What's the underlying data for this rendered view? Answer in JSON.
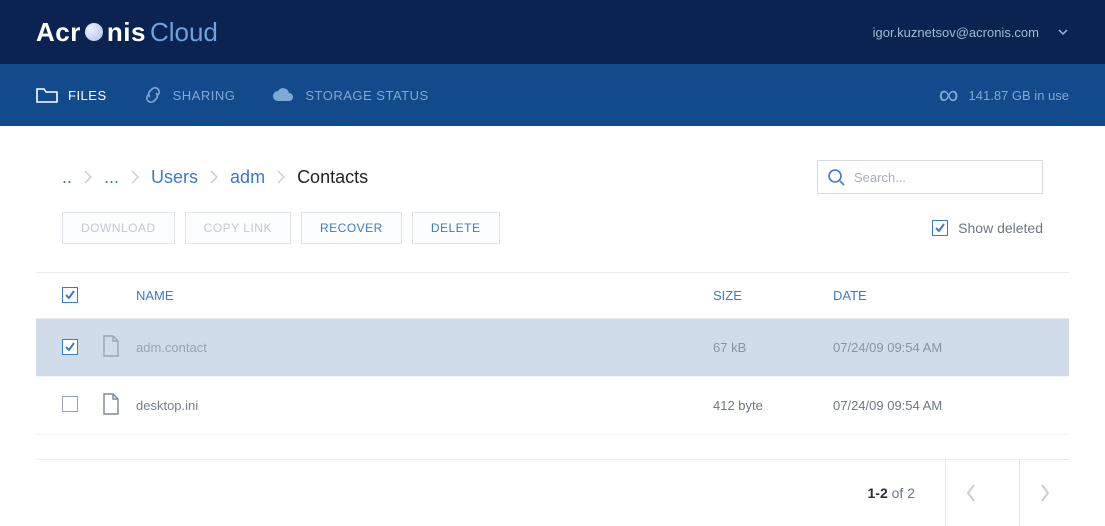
{
  "header": {
    "brand_a": "Acr",
    "brand_o": "o",
    "brand_nis": "nis",
    "brand_cloud": "Cloud",
    "user_email": "igor.kuznetsov@acronis.com"
  },
  "nav": {
    "files": "FILES",
    "sharing": "SHARING",
    "storage_status": "STORAGE STATUS",
    "usage": "141.87 GB in use"
  },
  "breadcrumb": {
    "root": "..",
    "more": "...",
    "users": "Users",
    "adm": "adm",
    "current": "Contacts"
  },
  "search": {
    "placeholder": "Search..."
  },
  "toolbar": {
    "download": "DOWNLOAD",
    "copylink": "COPY LINK",
    "recover": "RECOVER",
    "delete": "DELETE",
    "show_deleted": "Show deleted"
  },
  "table": {
    "col_name": "NAME",
    "col_size": "SIZE",
    "col_date": "DATE",
    "rows": [
      {
        "name": "adm.contact",
        "size": "67 kB",
        "date": "07/24/09 09:54 AM",
        "selected": true
      },
      {
        "name": "desktop.ini",
        "size": "412 byte",
        "date": "07/24/09 09:54 AM",
        "selected": false
      }
    ]
  },
  "pager": {
    "range": "1-2",
    "of_word": " of ",
    "total": "2"
  }
}
